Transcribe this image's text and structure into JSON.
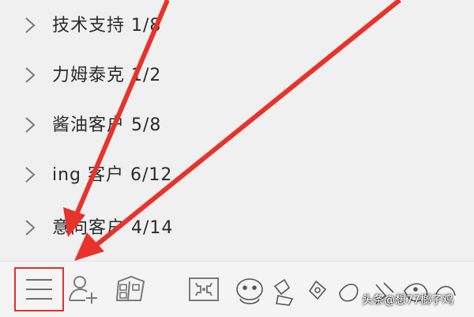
{
  "groups": [
    {
      "label": "技术支持 1/8"
    },
    {
      "label": "力姆泰克 1/2"
    },
    {
      "label": "酱油客户 5/8"
    },
    {
      "label": "ing 客户 6/12"
    },
    {
      "label": "意向客户 4/14"
    }
  ],
  "toolbar": {
    "items": [
      "menu-icon",
      "add-contact-icon",
      "app-box-icon",
      "game-icon",
      "decorative-emoji-icons"
    ]
  },
  "annotation": {
    "arrow_color": "#e8322c",
    "highlight_color": "#e2302c"
  },
  "watermark": {
    "text": "头条@想77榔子鸡"
  }
}
